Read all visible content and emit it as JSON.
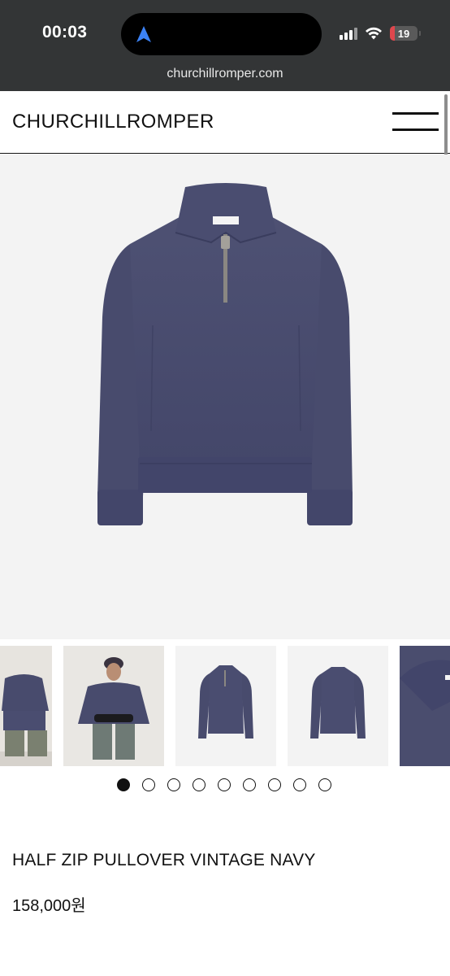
{
  "status_bar": {
    "time": "00:03",
    "battery": "19"
  },
  "browser": {
    "url": "churchillromper.com"
  },
  "header": {
    "brand": "CHURCHILLROMPER"
  },
  "gallery": {
    "dot_count": 9,
    "active_index": 0
  },
  "product": {
    "title": "HALF ZIP PULLOVER VINTAGE NAVY",
    "price": "158,000원"
  },
  "colors": {
    "sweater": "#4a4d6e",
    "hero_bg": "#f3f3f3",
    "browser_chrome": "#333536",
    "battery_low": "#e0474d"
  }
}
